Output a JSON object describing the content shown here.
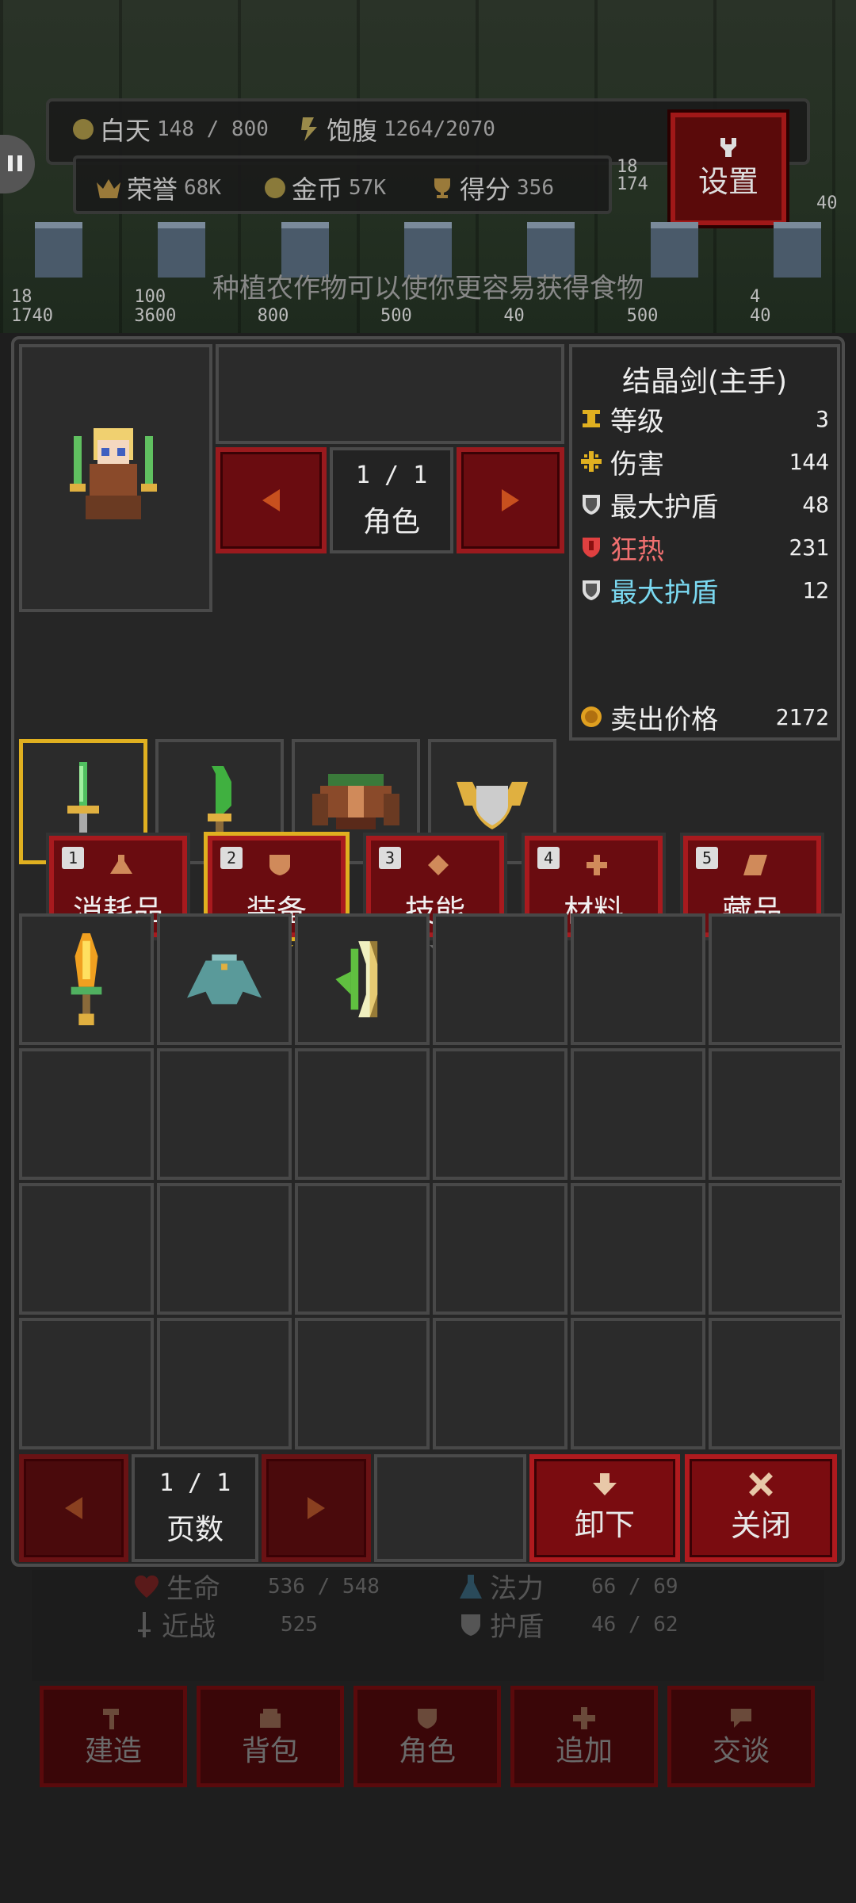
{
  "hud": {
    "day_label": "白天",
    "day_value": "148 / 800",
    "satiety_label": "饱腹",
    "satiety_value": "1264/2070",
    "honor_label": "荣誉",
    "honor_value": "68K",
    "gold_label": "金币",
    "gold_value": "57K",
    "score_label": "得分",
    "score_value": "356",
    "settings_label": "设置",
    "hint": "种植农作物可以使你更容易获得食物"
  },
  "towers": [
    {
      "a": "18",
      "b": "1740"
    },
    {
      "a": "100",
      "b": "3600"
    },
    {
      "a": "",
      "b": "800"
    },
    {
      "a": "",
      "b": "500"
    },
    {
      "a": "",
      "b": "40"
    },
    {
      "a": "",
      "b": "500"
    },
    {
      "a": "4",
      "b": "40"
    }
  ],
  "tower_side": {
    "a": "18",
    "b": "174",
    "c": "40"
  },
  "character": {
    "page": "1 / 1",
    "label": "角色"
  },
  "item_info": {
    "title": "结晶剑(主手)",
    "stats": [
      {
        "label": "等级",
        "value": "3",
        "icon": "level-icon",
        "color": "#eeeeee",
        "icon_color": "#e0b020"
      },
      {
        "label": "伤害",
        "value": "144",
        "icon": "damage-icon",
        "color": "#eeeeee",
        "icon_color": "#e0b020"
      },
      {
        "label": "最大护盾",
        "value": "48",
        "icon": "shield-icon",
        "color": "#eeeeee",
        "icon_color": "#dddddd"
      },
      {
        "label": "狂热",
        "value": "231",
        "icon": "frenzy-icon",
        "color": "#f07070",
        "icon_color": "#e04040"
      },
      {
        "label": "最大护盾",
        "value": "12",
        "icon": "shield-icon",
        "color": "#7ad8f0",
        "icon_color": "#dddddd"
      }
    ],
    "sell_label": "卖出价格",
    "sell_value": "2172"
  },
  "tabs": [
    {
      "num": "1",
      "label": "消耗品",
      "icon": "potion-icon",
      "selected": false
    },
    {
      "num": "2",
      "label": "装备",
      "icon": "armor-icon",
      "selected": true
    },
    {
      "num": "3",
      "label": "技能",
      "icon": "skill-icon",
      "selected": false
    },
    {
      "num": "4",
      "label": "材料",
      "icon": "material-icon",
      "selected": false
    },
    {
      "num": "5",
      "label": "藏品",
      "icon": "collection-icon",
      "selected": false
    }
  ],
  "pager": {
    "page": "1 / 1",
    "label": "页数"
  },
  "actions": {
    "unequip": "卸下",
    "close": "关闭"
  },
  "ghost_stats": {
    "hp_label": "生命",
    "hp_value": "536 / 548",
    "mana_label": "法力",
    "mana_value": "66 / 69",
    "melee_label": "近战",
    "melee_value": "525",
    "shield_label": "护盾",
    "shield_value": "46 / 62"
  },
  "bottom_nav": [
    "建造",
    "背包",
    "角色",
    "追加",
    "交谈"
  ]
}
